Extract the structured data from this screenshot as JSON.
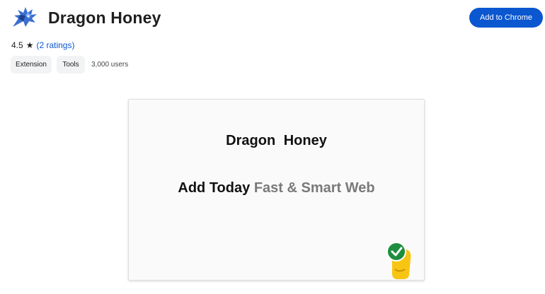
{
  "header": {
    "logo_icon": "dragon-icon",
    "title": "Dragon Honey",
    "add_button_label": "Add to Chrome"
  },
  "rating": {
    "score": "4.5",
    "star_icon": "★",
    "ratings_text": "(2 ratings)"
  },
  "chips": {
    "extension": "Extension",
    "tools": "Tools"
  },
  "users_text": "3,000 users",
  "promo": {
    "title": "Dragon Honey",
    "tagline_part1": "Add Today",
    "tagline_part2": "Fast & Smart Web",
    "badge_icon": "check-badge-icon"
  },
  "colors": {
    "accent": "#0b57d0",
    "chip_bg": "#f1f3f4",
    "badge_green": "#1e8e3e",
    "badge_yellow": "#f9c513",
    "logo_blue": "#3b6fd1"
  }
}
